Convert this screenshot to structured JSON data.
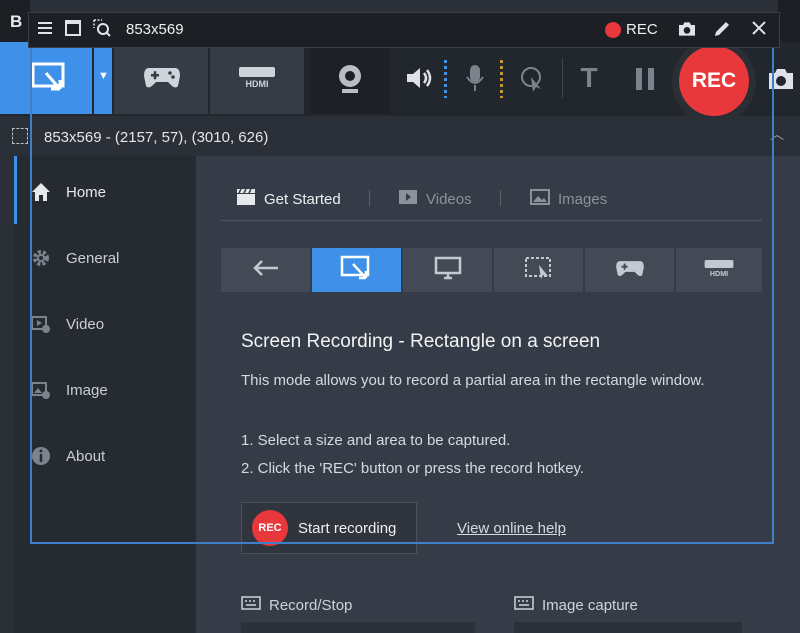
{
  "app": {
    "title_letter": "B"
  },
  "capture_bar": {
    "size_label": "853x569",
    "rec_label": "REC"
  },
  "toolbar": {
    "rec_button": "REC",
    "text_tool": "T"
  },
  "info_row": {
    "coords": "853x569 - (2157, 57), (3010, 626)"
  },
  "sidebar": {
    "items": [
      {
        "label": "Home",
        "icon": "home-icon"
      },
      {
        "label": "General",
        "icon": "gear-icon"
      },
      {
        "label": "Video",
        "icon": "video-settings-icon"
      },
      {
        "label": "Image",
        "icon": "image-settings-icon"
      },
      {
        "label": "About",
        "icon": "info-icon"
      }
    ]
  },
  "tabs": [
    {
      "label": "Get Started",
      "icon": "clapperboard-icon"
    },
    {
      "label": "Videos",
      "icon": "video-icon"
    },
    {
      "label": "Images",
      "icon": "image-icon"
    }
  ],
  "modes": [
    "back",
    "rectangle",
    "fullscreen",
    "around-mouse",
    "game",
    "hdmi"
  ],
  "content": {
    "heading": "Screen Recording - Rectangle on a screen",
    "description": "This mode allows you to record a partial area in the rectangle window.",
    "step1": "1. Select a size and area to be captured.",
    "step2": "2. Click the 'REC' button or press the record hotkey.",
    "start_recording": "Start recording",
    "rec_badge": "REC",
    "help_link": "View online help"
  },
  "hotkeys": {
    "record_stop": "Record/Stop",
    "image_capture": "Image capture"
  },
  "colors": {
    "accent": "#3e90e8",
    "rec_red": "#e8383c",
    "bg": "#2b3038",
    "panel": "#363c47"
  }
}
